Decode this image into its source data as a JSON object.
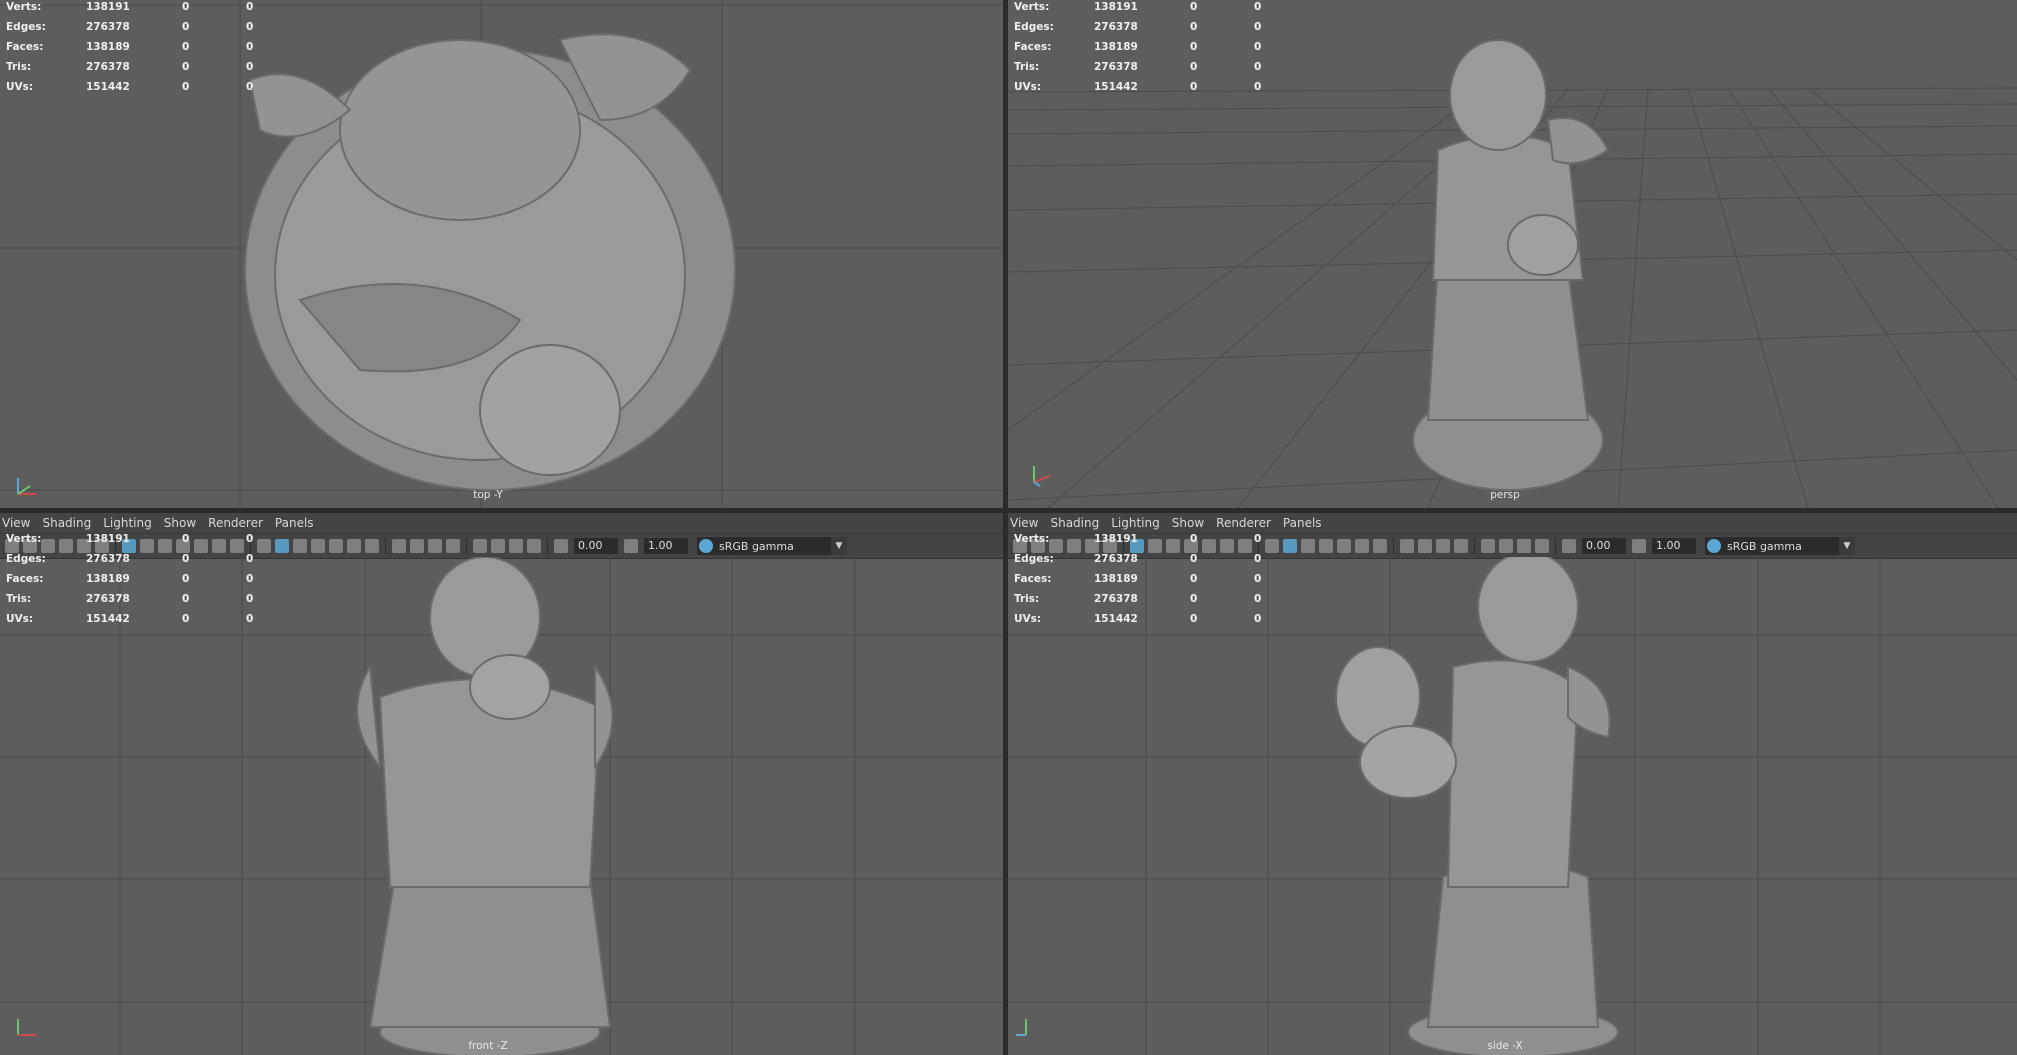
{
  "menu": [
    "View",
    "Shading",
    "Lighting",
    "Show",
    "Renderer",
    "Panels"
  ],
  "toolbar": {
    "exposure": "0.00",
    "gamma_value": "1.00",
    "color_space": "sRGB gamma"
  },
  "stats": {
    "labels": [
      "Verts:",
      "Edges:",
      "Faces:",
      "Tris:",
      "UVs:"
    ],
    "values": [
      [
        "138191",
        "0",
        "0"
      ],
      [
        "276378",
        "0",
        "0"
      ],
      [
        "138189",
        "0",
        "0"
      ],
      [
        "276378",
        "0",
        "0"
      ],
      [
        "151442",
        "0",
        "0"
      ]
    ]
  },
  "viewports": {
    "top": "top -Y",
    "persp": "persp",
    "front": "front -Z",
    "side": "side -X"
  },
  "colors": {
    "viewport_bg": "#5d5d5d",
    "panel_bg": "#444444",
    "grid": "#4a4a4a",
    "model": "#8f8f8f",
    "accent": "#5aa9d6"
  }
}
